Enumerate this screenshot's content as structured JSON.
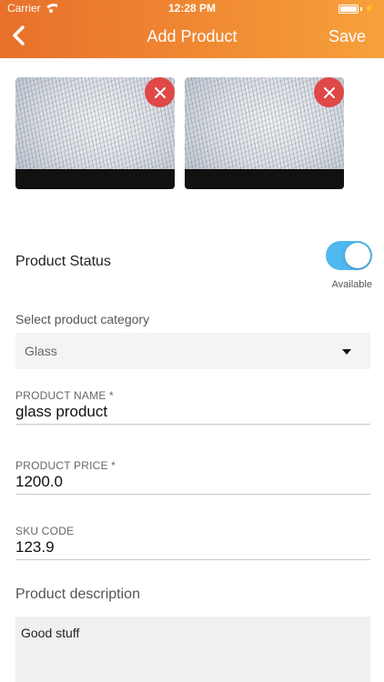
{
  "status_bar": {
    "carrier": "Carrier",
    "time": "12:28 PM"
  },
  "navbar": {
    "back_icon": "chevron-left-icon",
    "title": "Add Product",
    "save_label": "Save"
  },
  "images": [
    {
      "remove_icon": "close-icon"
    },
    {
      "remove_icon": "close-icon"
    }
  ],
  "product_status": {
    "label": "Product Status",
    "toggle_on": true,
    "caption": "Available",
    "toggle_color": "#4fb8ee"
  },
  "category": {
    "label": "Select product category",
    "selected": "Glass"
  },
  "fields": {
    "name": {
      "label": "PRODUCT NAME *",
      "value": "glass product"
    },
    "price": {
      "label": "PRODUCT PRICE *",
      "value": "1200.0"
    },
    "sku": {
      "label": "SKU CODE",
      "value": "123.9"
    }
  },
  "description": {
    "label": "Product description",
    "value": "Good stuff"
  },
  "colors": {
    "accent_start": "#e8702a",
    "accent_end": "#f7a13c",
    "remove_button": "#e04848"
  }
}
